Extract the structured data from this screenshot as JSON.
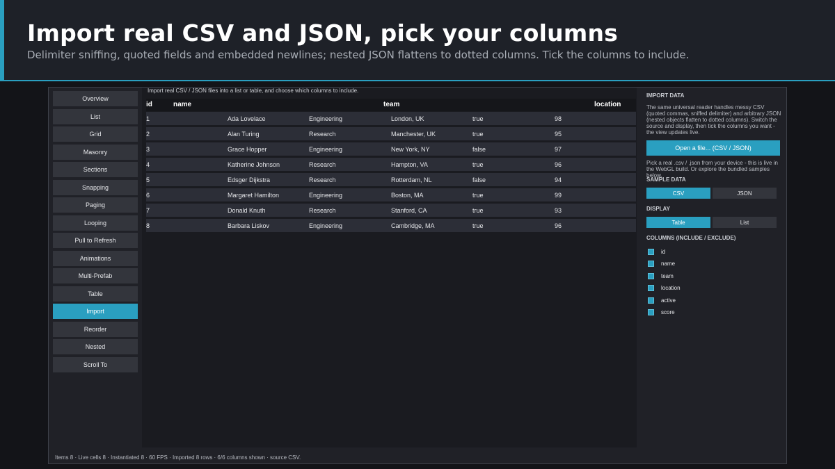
{
  "header": {
    "title": "Import real CSV and JSON, pick your columns",
    "subtitle": "Delimiter sniffing, quoted fields and embedded newlines; nested JSON flattens to dotted columns. Tick the columns to include."
  },
  "sidebar": {
    "items": [
      {
        "label": "Overview"
      },
      {
        "label": "List"
      },
      {
        "label": "Grid"
      },
      {
        "label": "Masonry"
      },
      {
        "label": "Sections"
      },
      {
        "label": "Snapping"
      },
      {
        "label": "Paging"
      },
      {
        "label": "Looping"
      },
      {
        "label": "Pull to Refresh"
      },
      {
        "label": "Animations"
      },
      {
        "label": "Multi-Prefab"
      },
      {
        "label": "Table"
      },
      {
        "label": "Import"
      },
      {
        "label": "Reorder"
      },
      {
        "label": "Nested"
      },
      {
        "label": "Scroll To"
      }
    ],
    "active": "Import"
  },
  "main": {
    "description": "Import real CSV / JSON files into a list or table, and choose which columns to include.",
    "headers": [
      "id",
      "name",
      "team",
      "location"
    ],
    "rows": [
      [
        "1",
        "Ada Lovelace",
        "Engineering",
        "London, UK",
        "true",
        "98"
      ],
      [
        "2",
        "Alan Turing",
        "Research",
        "Manchester, UK",
        "true",
        "95"
      ],
      [
        "3",
        "Grace Hopper",
        "Engineering",
        "New York, NY",
        "false",
        "97"
      ],
      [
        "4",
        "Katherine Johnson",
        "Research",
        "Hampton, VA",
        "true",
        "96"
      ],
      [
        "5",
        "Edsger Dijkstra",
        "Research",
        "Rotterdam, NL",
        "false",
        "94"
      ],
      [
        "6",
        "Margaret Hamilton",
        "Engineering",
        "Boston, MA",
        "true",
        "99"
      ],
      [
        "7",
        "Donald Knuth",
        "Research",
        "Stanford, CA",
        "true",
        "93"
      ],
      [
        "8",
        "Barbara Liskov",
        "Engineering",
        "Cambridge, MA",
        "true",
        "96"
      ]
    ]
  },
  "status": {
    "text": "Items 8  ·  Live cells 8  ·  Instantiated 8  ·  60 FPS  ·  Imported 8 rows · 6/6 columns shown · source CSV."
  },
  "panel": {
    "import_heading": "IMPORT DATA",
    "import_desc": "The same universal reader handles messy CSV (quoted commas, sniffed delimiter) and arbitrary JSON (nested objects flatten to dotted columns). Switch the source and display, then tick the columns you want - the view updates live.",
    "open_button": "Open a file...  (CSV / JSON)",
    "open_hint": "Pick a real .csv / .json from your device - this is live in the WebGL build. Or explore the bundled samples below.",
    "sample_heading": "SAMPLE DATA",
    "sample_options": [
      "CSV",
      "JSON"
    ],
    "sample_selected": "CSV",
    "display_heading": "DISPLAY",
    "display_options": [
      "Table",
      "List"
    ],
    "display_selected": "Table",
    "columns_heading": "COLUMNS (INCLUDE / EXCLUDE)",
    "columns": [
      {
        "label": "id",
        "checked": true
      },
      {
        "label": "name",
        "checked": true
      },
      {
        "label": "team",
        "checked": true
      },
      {
        "label": "location",
        "checked": true
      },
      {
        "label": "active",
        "checked": true
      },
      {
        "label": "score",
        "checked": true
      }
    ]
  },
  "colors": {
    "accent": "#2a9fc0",
    "background": "#131418",
    "panel": "#202127",
    "row": "#2c2e37"
  }
}
